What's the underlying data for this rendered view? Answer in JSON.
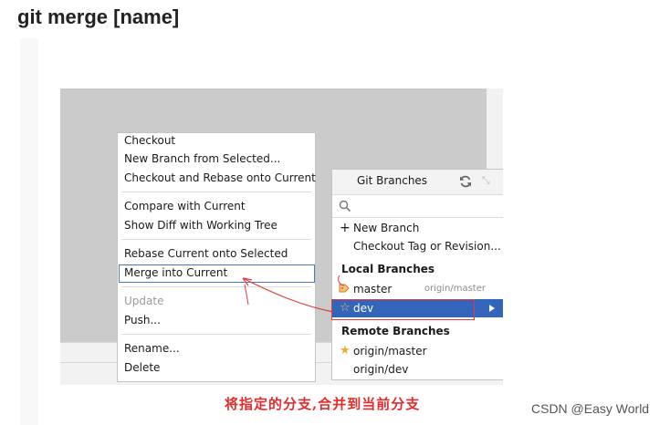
{
  "heading": "git merge [name]",
  "context_menu": {
    "items": [
      {
        "label": "Checkout"
      },
      {
        "label": "New Branch from Selected..."
      },
      {
        "label": "Checkout and Rebase onto Current"
      },
      {
        "label": "Compare with Current"
      },
      {
        "label": "Show Diff with Working Tree"
      },
      {
        "label": "Rebase Current onto Selected"
      },
      {
        "label": "Merge into Current",
        "highlighted": true
      },
      {
        "label": "Update",
        "disabled": true
      },
      {
        "label": "Push..."
      },
      {
        "label": "Rename..."
      },
      {
        "label": "Delete"
      }
    ]
  },
  "git_branches": {
    "title": "Git Branches",
    "refresh_icon": "refresh-icon",
    "expand_icon": "expand-icon",
    "search_icon": "search-icon",
    "actions": [
      {
        "label": "New Branch",
        "icon": "plus-icon"
      },
      {
        "label": "Checkout Tag or Revision..."
      }
    ],
    "local_header": "Local Branches",
    "local": [
      {
        "name": "master",
        "tracking": "origin/master",
        "icon": "tag-icon"
      },
      {
        "name": "dev",
        "selected": true,
        "icon": "star-outline-icon"
      }
    ],
    "remote_header": "Remote Branches",
    "remote": [
      {
        "name": "origin/master",
        "icon": "star-filled-icon"
      },
      {
        "name": "origin/dev"
      }
    ]
  },
  "annotation": {
    "caption": "将指定的分支,合并到当前分支",
    "color": "#e62b2b"
  },
  "watermark": "CSDN @Easy World",
  "colors": {
    "selection": "#3366bb",
    "focus_border": "#4a78c8"
  }
}
